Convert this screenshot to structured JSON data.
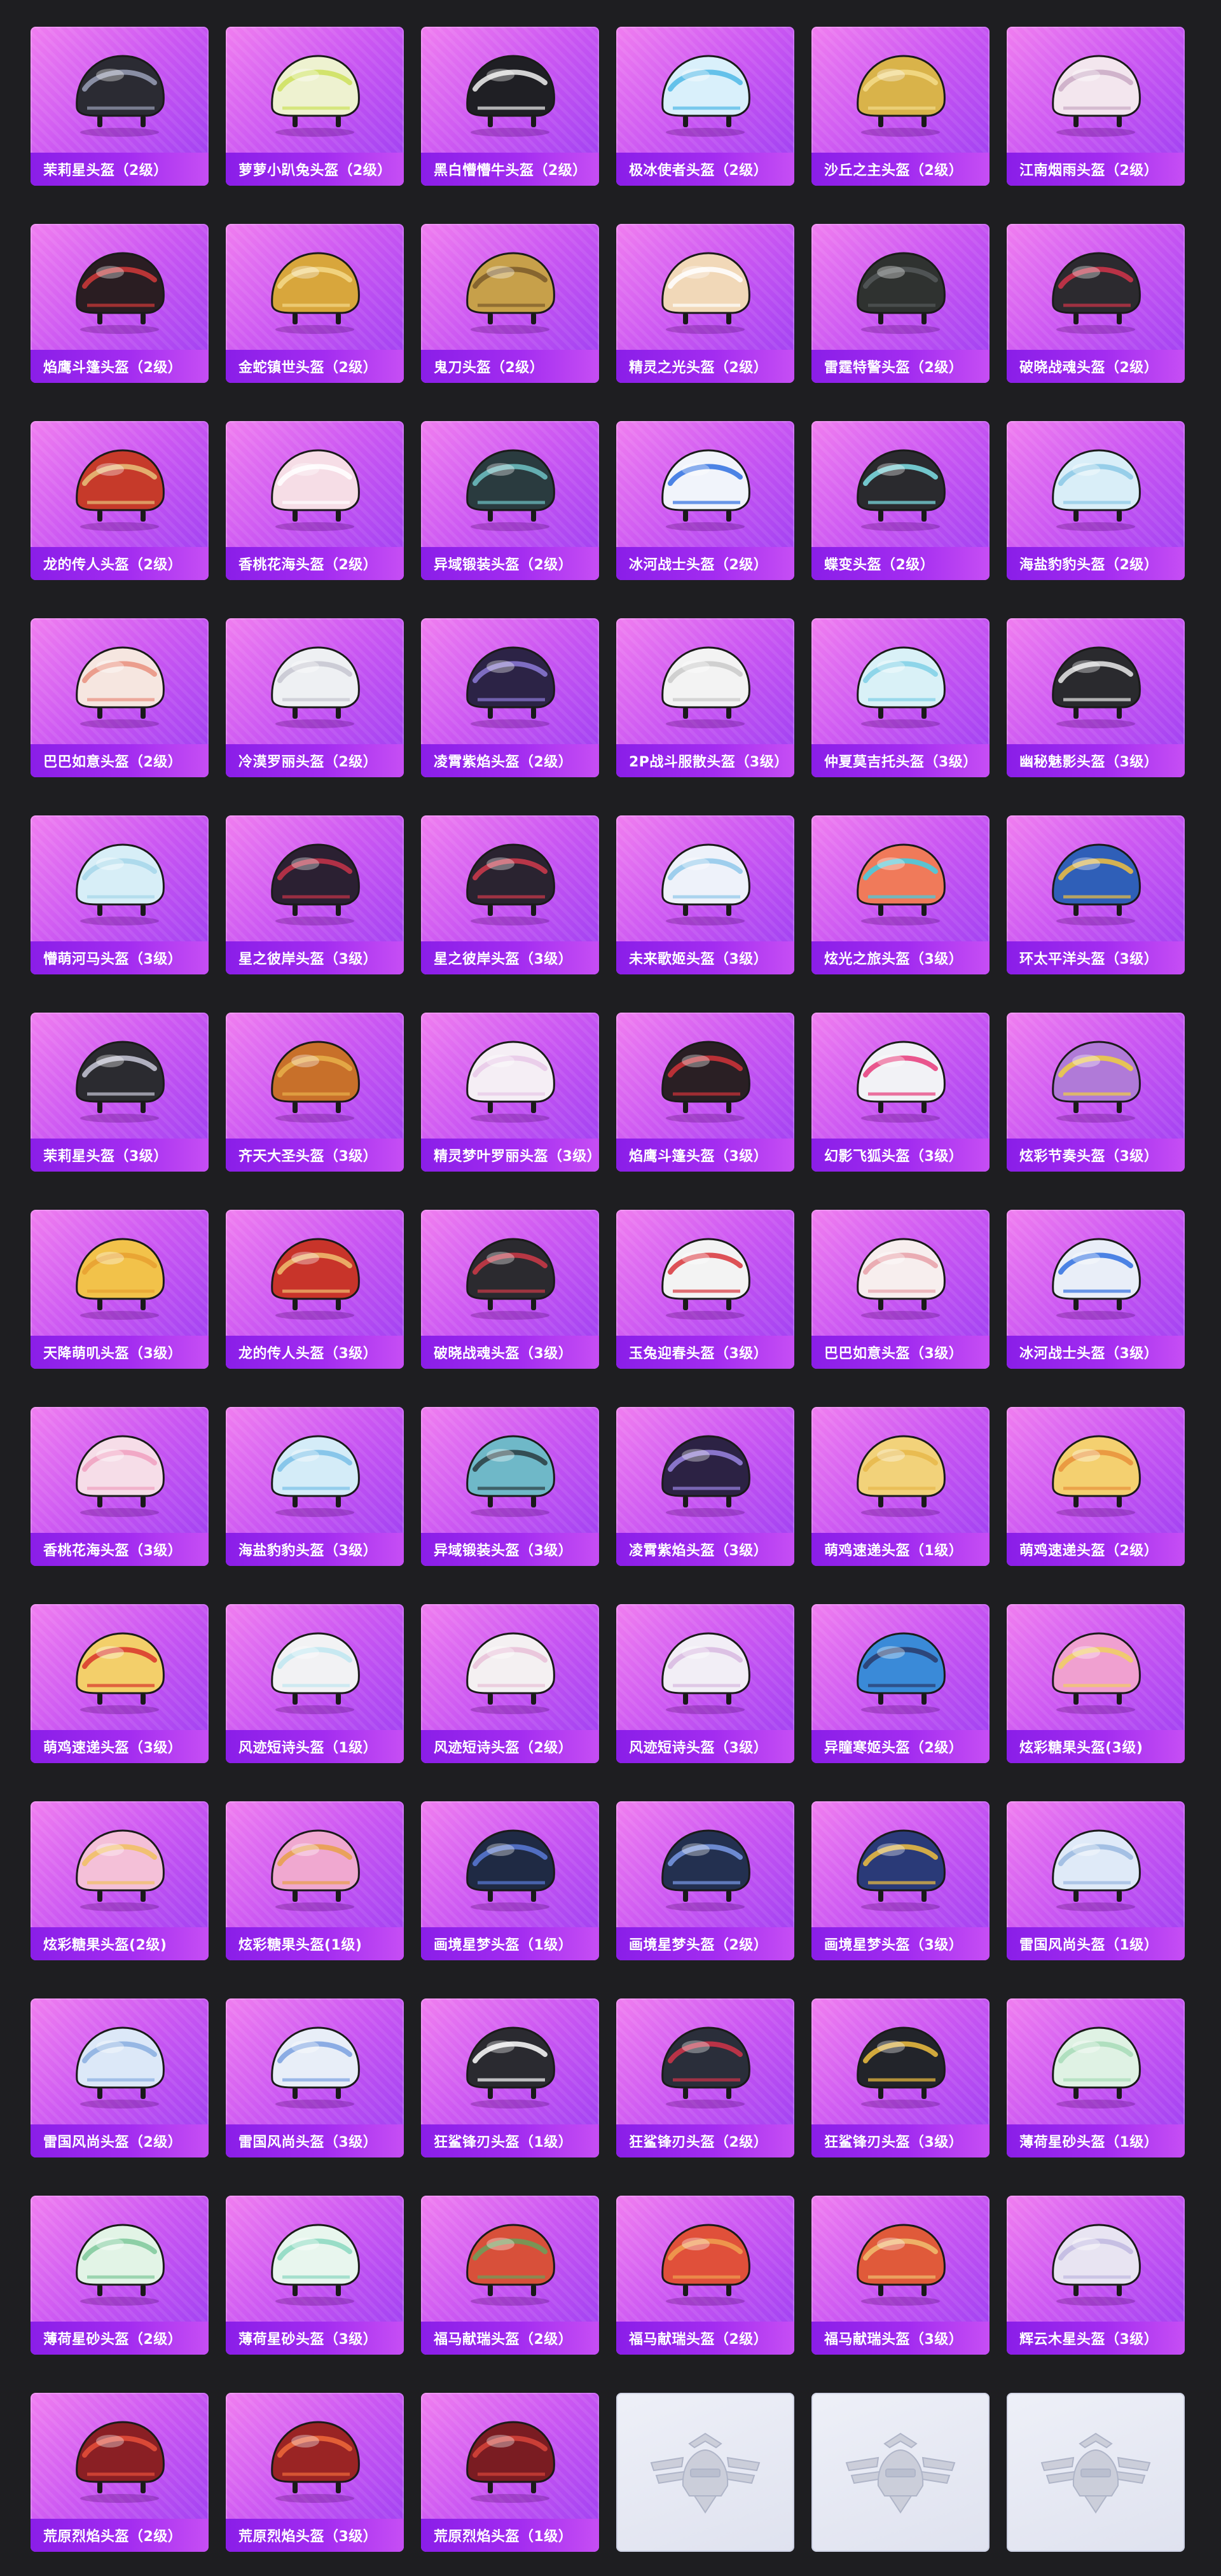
{
  "items": [
    {
      "label": "茉莉星头盔（2级）",
      "color": "#2b2b33",
      "accent": "#9aa0b8",
      "icon": "helmet-icon"
    },
    {
      "label": "萝萝小趴兔头盔（2级）",
      "color": "#eef2d0",
      "accent": "#cde15a",
      "icon": "helmet-icon"
    },
    {
      "label": "黑白懵懵牛头盔（2级）",
      "color": "#1f1f24",
      "accent": "#f1f1f1",
      "icon": "helmet-icon"
    },
    {
      "label": "极冰使者头盔（2级）",
      "color": "#d9f0fb",
      "accent": "#4fb8e6",
      "icon": "helmet-icon"
    },
    {
      "label": "沙丘之主头盔（2级）",
      "color": "#d9b34a",
      "accent": "#f3dc8a",
      "icon": "helmet-icon"
    },
    {
      "label": "江南烟雨头盔（2级）",
      "color": "#f3e6ee",
      "accent": "#c9a9c4",
      "icon": "helmet-icon"
    },
    {
      "label": "焰鹰斗篷头盔（2级）",
      "color": "#2a1d22",
      "accent": "#d23a3a",
      "icon": "helmet-icon"
    },
    {
      "label": "金蛇镇世头盔（2级）",
      "color": "#d8a63c",
      "accent": "#f4d98a",
      "icon": "helmet-icon"
    },
    {
      "label": "鬼刀头盔（2级）",
      "color": "#c7a04a",
      "accent": "#7a5a2a",
      "icon": "helmet-icon"
    },
    {
      "label": "精灵之光头盔（2级）",
      "color": "#f1d8b8",
      "accent": "#ffffff",
      "icon": "helmet-icon"
    },
    {
      "label": "雷霆特警头盔（2级）",
      "color": "#2f3230",
      "accent": "#55595a",
      "icon": "helmet-icon"
    },
    {
      "label": "破晓战魂头盔（2级）",
      "color": "#2c2a2f",
      "accent": "#d2344a",
      "icon": "helmet-icon"
    },
    {
      "label": "龙的传人头盔（2级）",
      "color": "#c63a2a",
      "accent": "#e8c27a",
      "icon": "helmet-icon"
    },
    {
      "label": "香桃花海头盔（2级）",
      "color": "#f6dde6",
      "accent": "#ffffff",
      "icon": "helmet-icon"
    },
    {
      "label": "异域锻装头盔（2级）",
      "color": "#2a3b3f",
      "accent": "#6fc3c6",
      "icon": "helmet-icon"
    },
    {
      "label": "冰河战士头盔（2级）",
      "color": "#f1f4fb",
      "accent": "#2f6fe0",
      "icon": "helmet-icon"
    },
    {
      "label": "蝶变头盔（2级）",
      "color": "#2a2a2e",
      "accent": "#7fe2e8",
      "icon": "helmet-icon"
    },
    {
      "label": "海盐豹豹头盔（2级）",
      "color": "#d9eef8",
      "accent": "#8bc8e6",
      "icon": "helmet-icon"
    },
    {
      "label": "巴巴如意头盔（2级）",
      "color": "#f6e6e0",
      "accent": "#e98f7e",
      "icon": "helmet-icon"
    },
    {
      "label": "冷漠罗丽头盔（2级）",
      "color": "#eef0f3",
      "accent": "#c6c6d0",
      "icon": "helmet-icon"
    },
    {
      "label": "凌霄紫焰头盔（2级）",
      "color": "#2c2346",
      "accent": "#8d7ad8",
      "icon": "helmet-icon"
    },
    {
      "label": "2P战斗服散头盔（3级）",
      "color": "#f3f3f3",
      "accent": "#c9c9c9",
      "icon": "helmet-icon"
    },
    {
      "label": "仲夏莫吉托头盔（3级）",
      "color": "#d9f1f7",
      "accent": "#7fd0e6",
      "icon": "helmet-icon"
    },
    {
      "label": "幽秘魅影头盔（3级）",
      "color": "#2a2a2e",
      "accent": "#eaeaea",
      "icon": "helmet-icon"
    },
    {
      "label": "懵萌河马头盔（3级）",
      "color": "#d7eef7",
      "accent": "#a6d6ea",
      "icon": "helmet-icon"
    },
    {
      "label": "星之彼岸头盔（3级）",
      "color": "#2b2032",
      "accent": "#c8344a",
      "icon": "helmet-icon"
    },
    {
      "label": "星之彼岸头盔（3级）",
      "color": "#2a2330",
      "accent": "#d13a4c",
      "icon": "helmet-icon"
    },
    {
      "label": "未来歌姬头盔（3级）",
      "color": "#eef2fa",
      "accent": "#8fc8ea",
      "icon": "helmet-icon"
    },
    {
      "label": "炫光之旅头盔（3级）",
      "color": "#f07a5a",
      "accent": "#3fd0e6",
      "icon": "helmet-icon"
    },
    {
      "label": "环太平洋头盔（3级）",
      "color": "#2f5fb8",
      "accent": "#f0c040",
      "icon": "helmet-icon"
    },
    {
      "label": "茉莉星头盔（3级）",
      "color": "#2b2b30",
      "accent": "#c8c8d8",
      "icon": "helmet-icon"
    },
    {
      "label": "齐天大圣头盔（3级）",
      "color": "#c8702a",
      "accent": "#e8b04a",
      "icon": "helmet-icon"
    },
    {
      "label": "精灵梦叶罗丽头盔（3级）",
      "color": "#f5eef5",
      "accent": "#e8c8e8",
      "icon": "helmet-icon"
    },
    {
      "label": "焰鹰斗篷头盔（3级）",
      "color": "#2a1f24",
      "accent": "#d2343a",
      "icon": "helmet-icon"
    },
    {
      "label": "幻影飞狐头盔（3级）",
      "color": "#f2f2f6",
      "accent": "#e83a7a",
      "icon": "helmet-icon"
    },
    {
      "label": "炫彩节奏头盔（3级）",
      "color": "#b07ad8",
      "accent": "#f0d040",
      "icon": "helmet-icon"
    },
    {
      "label": "天降萌叽头盔（3级）",
      "color": "#f2c24a",
      "accent": "#e8a030",
      "icon": "helmet-icon"
    },
    {
      "label": "龙的传人头盔（3级）",
      "color": "#c8342a",
      "accent": "#f0c070",
      "icon": "helmet-icon"
    },
    {
      "label": "破晓战魂头盔（3级）",
      "color": "#2b2a2f",
      "accent": "#d03a48",
      "icon": "helmet-icon"
    },
    {
      "label": "玉兔迎春头盔（3级）",
      "color": "#f3f3f3",
      "accent": "#d8343a",
      "icon": "helmet-icon"
    },
    {
      "label": "巴巴如意头盔（3级）",
      "color": "#f7eeee",
      "accent": "#e8a0a8",
      "icon": "helmet-icon"
    },
    {
      "label": "冰河战士头盔（3级）",
      "color": "#e9eef8",
      "accent": "#2f6fe0",
      "icon": "helmet-icon"
    },
    {
      "label": "香桃花海头盔（3级）",
      "color": "#f6dde8",
      "accent": "#f0a0c0",
      "icon": "helmet-icon"
    },
    {
      "label": "海盐豹豹头盔（3级）",
      "color": "#d4ecf8",
      "accent": "#7ac0e8",
      "icon": "helmet-icon"
    },
    {
      "label": "异域锻装头盔（3级）",
      "color": "#6fb8c8",
      "accent": "#2a3b3f",
      "icon": "helmet-icon"
    },
    {
      "label": "凌霄紫焰头盔（3级）",
      "color": "#2c2244",
      "accent": "#9a84e2",
      "icon": "helmet-icon"
    },
    {
      "label": "萌鸡速递头盔（1级）",
      "color": "#f2d27a",
      "accent": "#e8b84a",
      "icon": "helmet-icon"
    },
    {
      "label": "萌鸡速递头盔（2级）",
      "color": "#f4d070",
      "accent": "#e8903a",
      "icon": "helmet-icon"
    },
    {
      "label": "萌鸡速递头盔（3级）",
      "color": "#f3cf6a",
      "accent": "#d8342a",
      "icon": "helmet-icon"
    },
    {
      "label": "风迹短诗头盔（1级）",
      "color": "#f2f2f4",
      "accent": "#bfe6f0",
      "icon": "helmet-icon"
    },
    {
      "label": "风迹短诗头盔（2级）",
      "color": "#f4f0f2",
      "accent": "#e8c0d8",
      "icon": "helmet-icon"
    },
    {
      "label": "风迹短诗头盔（3级）",
      "color": "#f2eef6",
      "accent": "#d8b8e0",
      "icon": "helmet-icon"
    },
    {
      "label": "异瞳寒姬头盔（2级）",
      "color": "#3a8ad8",
      "accent": "#2a3a6a",
      "icon": "helmet-icon"
    },
    {
      "label": "炫彩糖果头盔(3级)",
      "color": "#f0a0d0",
      "accent": "#f0d060",
      "icon": "helmet-icon"
    },
    {
      "label": "炫彩糖果头盔(2级)",
      "color": "#f4c0d8",
      "accent": "#f0c060",
      "icon": "helmet-icon"
    },
    {
      "label": "炫彩糖果头盔(1级)",
      "color": "#f0a8d0",
      "accent": "#e8a048",
      "icon": "helmet-icon"
    },
    {
      "label": "画境星梦头盔（1级）",
      "color": "#1f2a44",
      "accent": "#5a7ad8",
      "icon": "helmet-icon"
    },
    {
      "label": "画境星梦头盔（2级）",
      "color": "#233050",
      "accent": "#7a9ae8",
      "icon": "helmet-icon"
    },
    {
      "label": "画境星梦头盔（3级）",
      "color": "#2a3a78",
      "accent": "#f0c040",
      "icon": "helmet-icon"
    },
    {
      "label": "雷国风尚头盔（1级）",
      "color": "#dfeaf8",
      "accent": "#9ab8e0",
      "icon": "helmet-icon"
    },
    {
      "label": "雷国风尚头盔（2级）",
      "color": "#dce8f8",
      "accent": "#8aaee0",
      "icon": "helmet-icon"
    },
    {
      "label": "雷国风尚头盔（3级）",
      "color": "#e8eef8",
      "accent": "#7aa0e0",
      "icon": "helmet-icon"
    },
    {
      "label": "狂鲨锋刃头盔（1级）",
      "color": "#2a2a30",
      "accent": "#ffffff",
      "icon": "helmet-icon"
    },
    {
      "label": "狂鲨锋刃头盔（2级）",
      "color": "#2a2e3a",
      "accent": "#d2344a",
      "icon": "helmet-icon"
    },
    {
      "label": "狂鲨锋刃头盔（3级）",
      "color": "#22242a",
      "accent": "#f0c040",
      "icon": "helmet-icon"
    },
    {
      "label": "薄荷星砂头盔（1级）",
      "color": "#dff2e4",
      "accent": "#a8dcb8",
      "icon": "helmet-icon"
    },
    {
      "label": "薄荷星砂头盔（2级）",
      "color": "#e2f4e6",
      "accent": "#7ec89a",
      "icon": "helmet-icon"
    },
    {
      "label": "薄荷星砂头盔（3级）",
      "color": "#e8f6ee",
      "accent": "#8ad8c0",
      "icon": "helmet-icon"
    },
    {
      "label": "福马献瑞头盔（2级）",
      "color": "#d8503a",
      "accent": "#6aa05a",
      "icon": "helmet-icon"
    },
    {
      "label": "福马献瑞头盔（2级）",
      "color": "#e0503a",
      "accent": "#f0a050",
      "icon": "helmet-icon"
    },
    {
      "label": "福马献瑞头盔（3级）",
      "color": "#e05a3a",
      "accent": "#f0c070",
      "icon": "helmet-icon"
    },
    {
      "label": "辉云木星头盔（3级）",
      "color": "#e8e4f2",
      "accent": "#c0b8e0",
      "icon": "helmet-icon"
    },
    {
      "label": "荒原烈焰头盔（2级）",
      "color": "#8a1f24",
      "accent": "#e8503a",
      "icon": "helmet-icon"
    },
    {
      "label": "荒原烈焰头盔（3级）",
      "color": "#9a2424",
      "accent": "#f06a3a",
      "icon": "helmet-icon"
    },
    {
      "label": "荒原烈焰头盔（1级）",
      "color": "#7a1c22",
      "accent": "#d8443a",
      "icon": "helmet-icon"
    },
    {
      "label": "",
      "placeholder": true,
      "icon": "placeholder-emblem-icon"
    },
    {
      "label": "",
      "placeholder": true,
      "icon": "placeholder-emblem-icon"
    },
    {
      "label": "",
      "placeholder": true,
      "icon": "placeholder-emblem-icon"
    }
  ]
}
